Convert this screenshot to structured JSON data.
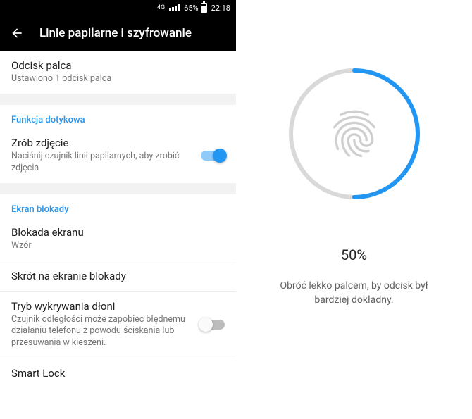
{
  "status": {
    "net": "4G",
    "battery_pct": "65%",
    "time": "22:18"
  },
  "appbar": {
    "title": "Linie papilarne i szyfrowanie"
  },
  "rows": {
    "fingerprint": {
      "title": "Odcisk palca",
      "subtitle": "Ustawiono 1 odcisk palca"
    },
    "touch_section": "Funkcja dotykowa",
    "take_photo": {
      "title": "Zrób zdjęcie",
      "subtitle": "Naciśnij czujnik linii papilarnych, aby zrobić zdjęcia"
    },
    "lock_section": "Ekran blokady",
    "screen_lock": {
      "title": "Blokada ekranu",
      "subtitle": "Wzór"
    },
    "shortcut": {
      "title": "Skrót na ekranie blokady"
    },
    "palm": {
      "title": "Tryb wykrywania dłoni",
      "subtitle": "Czujnik odległości może zapobiec błędnemu działaniu telefonu z powodu ściskania lub przesuwania w kieszeni."
    },
    "smartlock": {
      "title": "Smart Lock"
    }
  },
  "enroll": {
    "percent": "50%",
    "tip_line1": "Obróć lekko palcem, by odcisk był",
    "tip_line2": "bardziej dokładny."
  },
  "colors": {
    "accent": "#2196f3",
    "ring_bg": "#d9d9d9"
  }
}
